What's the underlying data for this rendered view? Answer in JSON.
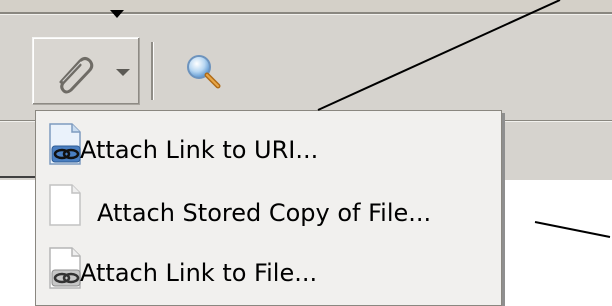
{
  "toolbar": {
    "attach_button_icon": "paperclip-icon",
    "dropdown_icon": "chevron-down-icon",
    "search_icon": "magnifier-icon"
  },
  "menu": {
    "items": [
      {
        "label": "Attach Link to URI...",
        "icon": "link-document-icon"
      },
      {
        "label": "Attach Stored Copy of File...",
        "icon": "document-icon"
      },
      {
        "label": "Attach Link to File...",
        "icon": "link-document-icon"
      }
    ]
  },
  "colors": {
    "toolbar_bg": "#d6d3ce",
    "menu_bg": "#f1f0ee",
    "link_icon_blue": "#4a7fc1"
  }
}
